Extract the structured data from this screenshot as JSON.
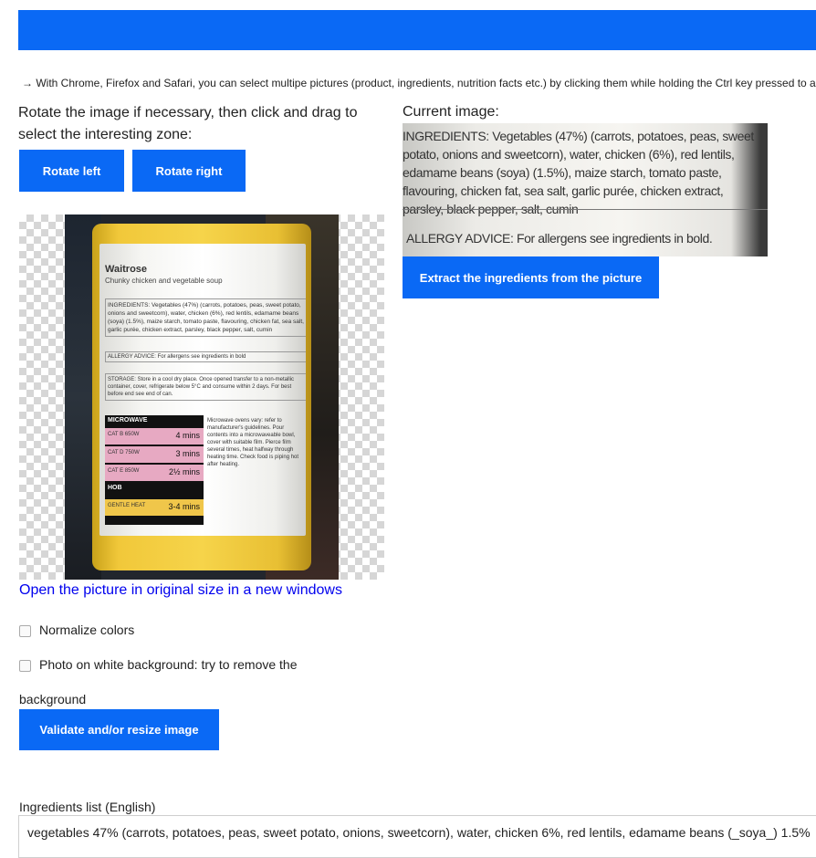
{
  "hint": "→ With Chrome, Firefox and Safari, you can select multipe pictures (product, ingredients, nutrition facts etc.) by clicking them while holding the Ctrl key pressed to add them all in one shot.",
  "instructions": "Rotate the image if necessary, then click and drag to select the interesting zone:",
  "buttons": {
    "rotate_left": "Rotate left",
    "rotate_right": "Rotate right",
    "extract": "Extract the ingredients from the picture",
    "validate": "Validate and/or resize image"
  },
  "current_image_label": "Current image:",
  "photo": {
    "brand": "Waitrose",
    "product": "Chunky chicken and vegetable soup",
    "ingredients_text": "INGREDIENTS: Vegetables (47%) (carrots, potatoes, peas, sweet potato, onions and sweetcorn), water, chicken (6%), red lentils, edamame beans (soya) (1.5%), maize starch, tomato paste, flavouring, chicken fat, sea salt, garlic purée, chicken extract, parsley, black pepper, salt, cumin",
    "allergy_text": "ALLERGY ADVICE: For allergens see ingredients in bold",
    "storage_text": "STORAGE: Store in a cool dry place. Once opened transfer to a non-metallic container, cover, refrigerate below 5°C and consume within 2 days. For best before end see end of can.",
    "microwave_title": "MICROWAVE",
    "microwave_rows": [
      {
        "label": "CAT B 650W",
        "time": "4 mins"
      },
      {
        "label": "CAT D 750W",
        "time": "3 mins"
      },
      {
        "label": "CAT E 850W",
        "time": "2½ mins"
      },
      {
        "label": "HOB",
        "time": ""
      },
      {
        "label": "GENTLE HEAT",
        "time": "3-4 mins"
      }
    ],
    "microwave_note": "Microwave ovens vary: refer to manufacturer's guidelines. Pour contents into a microwaveable bowl, cover with suitable film. Pierce film several times, heat halfway through heating time. Check food is piping hot after heating."
  },
  "preview": {
    "ingredients_text": "INGREDIENTS: Vegetables (47%) (carrots, potatoes, peas, sweet potato, onions and sweetcorn), water, chicken (6%), red lentils, edamame beans (soya) (1.5%), maize starch, tomato paste, flavouring, chicken fat, sea salt, garlic purée, chicken extract, parsley, black pepper, salt, cumin",
    "allergy_text": "ALLERGY ADVICE: For allergens see ingredients in bold."
  },
  "original_link": "Open the picture in original size in a new windows",
  "options": {
    "normalize": "Normalize colors",
    "white_bg": "Photo on white background: try to remove the",
    "white_bg_cont": "background"
  },
  "ingredients": {
    "label": "Ingredients list (English)",
    "value": "vegetables 47% (carrots, potatoes, peas, sweet potato, onions, sweetcorn), water, chicken 6%, red lentils, edamame beans (_soya_) 1.5%"
  },
  "colors": {
    "primary": "#0a69f5",
    "link": "#0000ee"
  }
}
